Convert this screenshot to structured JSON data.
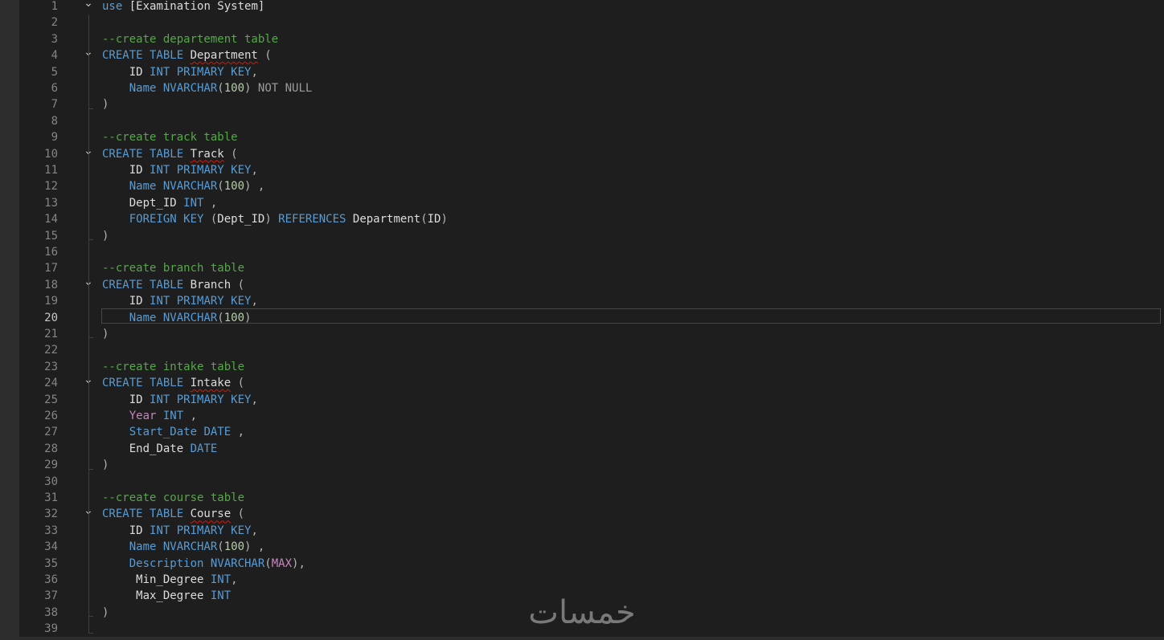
{
  "editor": {
    "active_line": 20,
    "lines": [
      {
        "n": "1",
        "fold": true,
        "tokens": [
          {
            "t": "use",
            "c": "kw"
          },
          {
            "t": " [Examination System]",
            "c": "id"
          }
        ]
      },
      {
        "n": "2",
        "tokens": []
      },
      {
        "n": "3",
        "tokens": [
          {
            "t": "--create departement table",
            "c": "cm"
          }
        ]
      },
      {
        "n": "4",
        "fold": true,
        "tokens": [
          {
            "t": "CREATE TABLE ",
            "c": "kw"
          },
          {
            "t": "Department",
            "c": "id",
            "squig": true
          },
          {
            "t": " (",
            "c": "pn"
          }
        ]
      },
      {
        "n": "5",
        "tokens": [
          {
            "t": "    ID ",
            "c": "id"
          },
          {
            "t": "INT PRIMARY KEY",
            "c": "kw"
          },
          {
            "t": ",",
            "c": "pn"
          }
        ]
      },
      {
        "n": "6",
        "tokens": [
          {
            "t": "    Name ",
            "c": "kw"
          },
          {
            "t": "NVARCHAR",
            "c": "kw"
          },
          {
            "t": "(",
            "c": "pn"
          },
          {
            "t": "100",
            "c": "num"
          },
          {
            "t": ")",
            "c": "pn"
          },
          {
            "t": " NOT NULL",
            "c": "gr"
          }
        ]
      },
      {
        "n": "7",
        "tokens": [
          {
            "t": ")",
            "c": "pn"
          }
        ]
      },
      {
        "n": "8",
        "tokens": []
      },
      {
        "n": "9",
        "tokens": [
          {
            "t": "--create track table",
            "c": "cm"
          }
        ]
      },
      {
        "n": "10",
        "fold": true,
        "tokens": [
          {
            "t": "CREATE TABLE ",
            "c": "kw"
          },
          {
            "t": "Track",
            "c": "id",
            "squig": true
          },
          {
            "t": " (",
            "c": "pn"
          }
        ]
      },
      {
        "n": "11",
        "tokens": [
          {
            "t": "    ID ",
            "c": "id"
          },
          {
            "t": "INT PRIMARY KEY",
            "c": "kw"
          },
          {
            "t": ",",
            "c": "pn"
          }
        ]
      },
      {
        "n": "12",
        "tokens": [
          {
            "t": "    Name ",
            "c": "kw"
          },
          {
            "t": "NVARCHAR",
            "c": "kw"
          },
          {
            "t": "(",
            "c": "pn"
          },
          {
            "t": "100",
            "c": "num"
          },
          {
            "t": ") ,",
            "c": "pn"
          }
        ]
      },
      {
        "n": "13",
        "tokens": [
          {
            "t": "    Dept_ID ",
            "c": "id"
          },
          {
            "t": "INT",
            "c": "kw"
          },
          {
            "t": " ,",
            "c": "pn"
          }
        ]
      },
      {
        "n": "14",
        "tokens": [
          {
            "t": "    FOREIGN KEY ",
            "c": "kw"
          },
          {
            "t": "(",
            "c": "pn"
          },
          {
            "t": "Dept_ID",
            "c": "id"
          },
          {
            "t": ") ",
            "c": "pn"
          },
          {
            "t": "REFERENCES ",
            "c": "kw"
          },
          {
            "t": "Department",
            "c": "id"
          },
          {
            "t": "(",
            "c": "pn"
          },
          {
            "t": "ID",
            "c": "id"
          },
          {
            "t": ")",
            "c": "pn"
          }
        ]
      },
      {
        "n": "15",
        "tokens": [
          {
            "t": ")",
            "c": "pn"
          }
        ]
      },
      {
        "n": "16",
        "tokens": []
      },
      {
        "n": "17",
        "tokens": [
          {
            "t": "--create branch table",
            "c": "cm"
          }
        ]
      },
      {
        "n": "18",
        "fold": true,
        "tokens": [
          {
            "t": "CREATE TABLE ",
            "c": "kw"
          },
          {
            "t": "Branch",
            "c": "id"
          },
          {
            "t": " (",
            "c": "pn"
          }
        ]
      },
      {
        "n": "19",
        "tokens": [
          {
            "t": "    ID ",
            "c": "id"
          },
          {
            "t": "INT PRIMARY KEY",
            "c": "kw"
          },
          {
            "t": ",",
            "c": "pn"
          }
        ]
      },
      {
        "n": "20",
        "tokens": [
          {
            "t": "    Name ",
            "c": "kw"
          },
          {
            "t": "NVARCHAR",
            "c": "kw"
          },
          {
            "t": "(",
            "c": "pn"
          },
          {
            "t": "100",
            "c": "num"
          },
          {
            "t": ")",
            "c": "pn"
          }
        ]
      },
      {
        "n": "21",
        "tokens": [
          {
            "t": ")",
            "c": "pn"
          }
        ]
      },
      {
        "n": "22",
        "tokens": []
      },
      {
        "n": "23",
        "tokens": [
          {
            "t": "--create intake table",
            "c": "cm"
          }
        ]
      },
      {
        "n": "24",
        "fold": true,
        "tokens": [
          {
            "t": "CREATE TABLE ",
            "c": "kw"
          },
          {
            "t": "Intake",
            "c": "id",
            "squig": true
          },
          {
            "t": " (",
            "c": "pn"
          }
        ]
      },
      {
        "n": "25",
        "tokens": [
          {
            "t": "    ID ",
            "c": "id"
          },
          {
            "t": "INT PRIMARY KEY",
            "c": "kw"
          },
          {
            "t": ",",
            "c": "pn"
          }
        ]
      },
      {
        "n": "26",
        "tokens": [
          {
            "t": "    ",
            "c": "id"
          },
          {
            "t": "Year",
            "c": "mg"
          },
          {
            "t": " INT",
            "c": "kw"
          },
          {
            "t": " ,",
            "c": "pn"
          }
        ]
      },
      {
        "n": "27",
        "tokens": [
          {
            "t": "    Start_Date ",
            "c": "kw"
          },
          {
            "t": "DATE",
            "c": "kw"
          },
          {
            "t": " ,",
            "c": "pn"
          }
        ]
      },
      {
        "n": "28",
        "tokens": [
          {
            "t": "    End_Date ",
            "c": "id"
          },
          {
            "t": "DATE",
            "c": "kw"
          }
        ]
      },
      {
        "n": "29",
        "tokens": [
          {
            "t": ")",
            "c": "pn"
          }
        ]
      },
      {
        "n": "30",
        "tokens": []
      },
      {
        "n": "31",
        "tokens": [
          {
            "t": "--create course table",
            "c": "cm"
          }
        ]
      },
      {
        "n": "32",
        "fold": true,
        "tokens": [
          {
            "t": "CREATE TABLE ",
            "c": "kw"
          },
          {
            "t": "Course",
            "c": "id",
            "squig": true
          },
          {
            "t": " (",
            "c": "pn"
          }
        ]
      },
      {
        "n": "33",
        "tokens": [
          {
            "t": "    ID ",
            "c": "id"
          },
          {
            "t": "INT PRIMARY KEY",
            "c": "kw"
          },
          {
            "t": ",",
            "c": "pn"
          }
        ]
      },
      {
        "n": "34",
        "tokens": [
          {
            "t": "    Name ",
            "c": "kw"
          },
          {
            "t": "NVARCHAR",
            "c": "kw"
          },
          {
            "t": "(",
            "c": "pn"
          },
          {
            "t": "100",
            "c": "num"
          },
          {
            "t": ") ,",
            "c": "pn"
          }
        ]
      },
      {
        "n": "35",
        "tokens": [
          {
            "t": "    Description ",
            "c": "kw"
          },
          {
            "t": "NVARCHAR",
            "c": "kw"
          },
          {
            "t": "(",
            "c": "pn"
          },
          {
            "t": "MAX",
            "c": "mg"
          },
          {
            "t": "),",
            "c": "pn"
          }
        ]
      },
      {
        "n": "36",
        "tokens": [
          {
            "t": "     Min_Degree ",
            "c": "id"
          },
          {
            "t": "INT",
            "c": "kw"
          },
          {
            "t": ",",
            "c": "pn"
          }
        ]
      },
      {
        "n": "37",
        "tokens": [
          {
            "t": "     Max_Degree ",
            "c": "id"
          },
          {
            "t": "INT",
            "c": "kw"
          }
        ]
      },
      {
        "n": "38",
        "tokens": [
          {
            "t": ")",
            "c": "pn"
          }
        ]
      },
      {
        "n": "39",
        "tokens": []
      }
    ]
  },
  "watermark": {
    "text": "خمسات",
    "color": "#8a8a8a"
  },
  "colors": {
    "background": "#1e1e1e",
    "keyword": "#569cd6",
    "comment": "#57a64a",
    "identifier": "#dcdcdc",
    "number": "#b5cea8",
    "line_number": "#858585",
    "magenta": "#c586c0"
  }
}
